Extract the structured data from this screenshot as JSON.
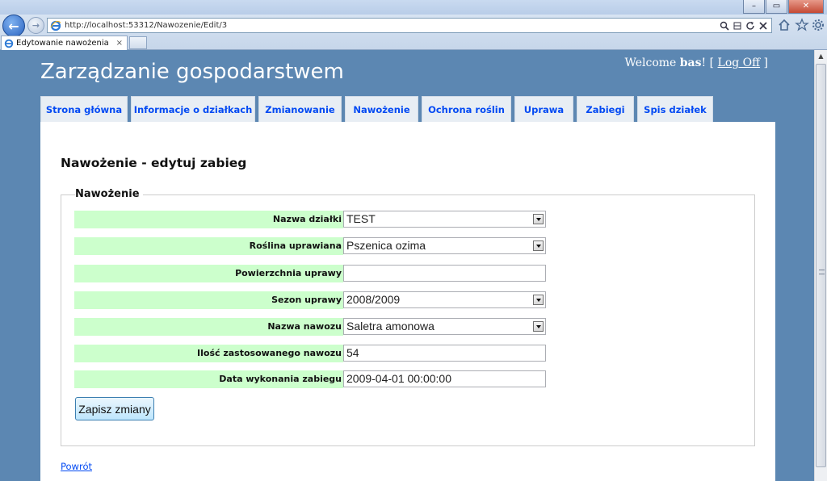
{
  "browser": {
    "url": "http://localhost:53312/Nawozenie/Edit/3",
    "tab_title": "Edytowanie nawożenia",
    "tab_close": "×",
    "win_min": "–",
    "win_max": "▭",
    "win_close": "✕",
    "back_icon": "←",
    "forward_icon": "→"
  },
  "site": {
    "title": "Zarządzanie gospodarstwem",
    "welcome_prefix": "Welcome ",
    "username": "bas",
    "welcome_suffix": "! [ ",
    "logoff_label": "Log Off",
    "bracket_close": " ]"
  },
  "menu": [
    {
      "label": "Strona główna"
    },
    {
      "label": "Informacje o działkach"
    },
    {
      "label": "Zmianowanie"
    },
    {
      "label": "Nawożenie"
    },
    {
      "label": "Ochrona roślin"
    },
    {
      "label": "Uprawa"
    },
    {
      "label": "Zabiegi"
    },
    {
      "label": "Spis działek"
    }
  ],
  "page": {
    "heading": "Nawożenie - edytuj zabieg",
    "legend": "Nawożenie",
    "save_label": "Zapisz zmiany",
    "back_link": "Powrót"
  },
  "form": {
    "fields": [
      {
        "label": "Nazwa działki",
        "value": "TEST",
        "type": "select"
      },
      {
        "label": "Roślina uprawiana",
        "value": "Pszenica ozima",
        "type": "select"
      },
      {
        "label": "Powierzchnia uprawy",
        "value": "",
        "type": "text"
      },
      {
        "label": "Sezon uprawy",
        "value": "2008/2009",
        "type": "select"
      },
      {
        "label": "Nazwa nawozu",
        "value": "Saletra amonowa",
        "type": "select"
      },
      {
        "label": "Ilość zastosowanego nawozu",
        "value": "54",
        "type": "text"
      },
      {
        "label": "Data wykonania zabiegu",
        "value": "2009-04-01 00:00:00",
        "type": "text"
      }
    ]
  },
  "colors": {
    "page_bg": "#5c87b2",
    "menu_text": "#034af3",
    "label_bg": "#ccffcc"
  }
}
